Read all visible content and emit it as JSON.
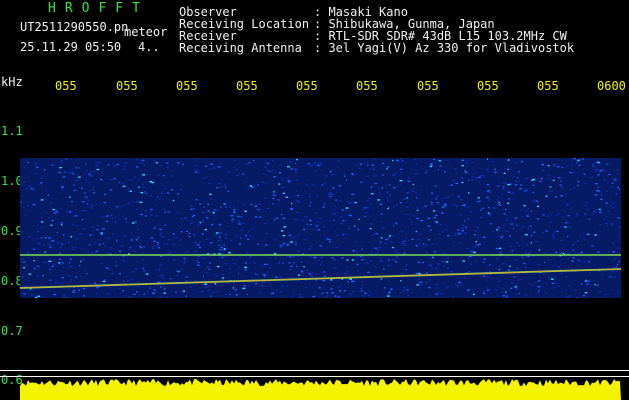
{
  "header": {
    "logo": "HROFFT",
    "filename": "UT2511290550.pn",
    "meteor_label": "meteor",
    "datetime": "25.11.29 05:50",
    "count": "4..",
    "info_labels": [
      "Observer",
      "Receiving Location",
      "Receiver",
      "Receiving Antenna"
    ],
    "info_values": [
      ": Masaki Kano",
      ": Shibukawa, Gunma, Japan",
      ": RTL-SDR SDR# 43dB L15 103.2MHz CW",
      ": 3el Yagi(V) Az 330 for Vladivostok"
    ]
  },
  "axes": {
    "unit": "kHz",
    "time_ticks": [
      "055",
      "055",
      "055",
      "055",
      "055",
      "055",
      "055",
      "055",
      "055",
      "0600"
    ],
    "freq_ticks": [
      "1.1",
      "1.0",
      "0.9",
      "0.8",
      "0.7",
      "0.6"
    ]
  },
  "colors": {
    "text_green": "#35e24a",
    "text_white": "#f2f2f2",
    "text_yellow": "#f4f400",
    "background": "#000000",
    "noise_blue": "#1f5dff",
    "echo_green": "#8cff50",
    "echo_orange": "#ff8a2a"
  }
}
